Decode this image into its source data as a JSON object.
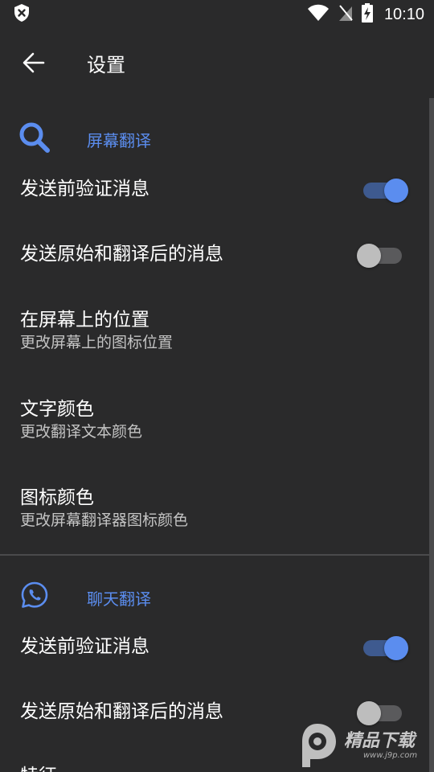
{
  "status_bar": {
    "time": "10:10",
    "icons": [
      "shield-x-icon",
      "wifi-icon",
      "no-sim-icon",
      "battery-charging-icon"
    ]
  },
  "toolbar": {
    "title": "设置",
    "back_icon": "arrow-back-icon"
  },
  "colors": {
    "background": "#2a2a2b",
    "accent": "#5b8def",
    "text_primary": "#ffffff",
    "text_secondary": "#c4c4c4"
  },
  "sections": [
    {
      "title": "屏幕翻译",
      "icon": "search-icon",
      "items": [
        {
          "title": "发送前验证消息",
          "toggle": true
        },
        {
          "title": "发送原始和翻译后的消息",
          "toggle": false
        },
        {
          "title": "在屏幕上的位置",
          "subtitle": "更改屏幕上的图标位置"
        },
        {
          "title": "文字颜色",
          "subtitle": "更改翻译文本颜色"
        },
        {
          "title": "图标颜色",
          "subtitle": "更改屏幕翻译器图标颜色"
        }
      ]
    },
    {
      "title": "聊天翻译",
      "icon": "whatsapp-icon",
      "items": [
        {
          "title": "发送前验证消息",
          "toggle": true
        },
        {
          "title": "发送原始和翻译后的消息",
          "toggle": false
        },
        {
          "title": "特征"
        }
      ]
    }
  ],
  "watermark": {
    "text": "精品下载",
    "url": "www.j9p.com"
  }
}
